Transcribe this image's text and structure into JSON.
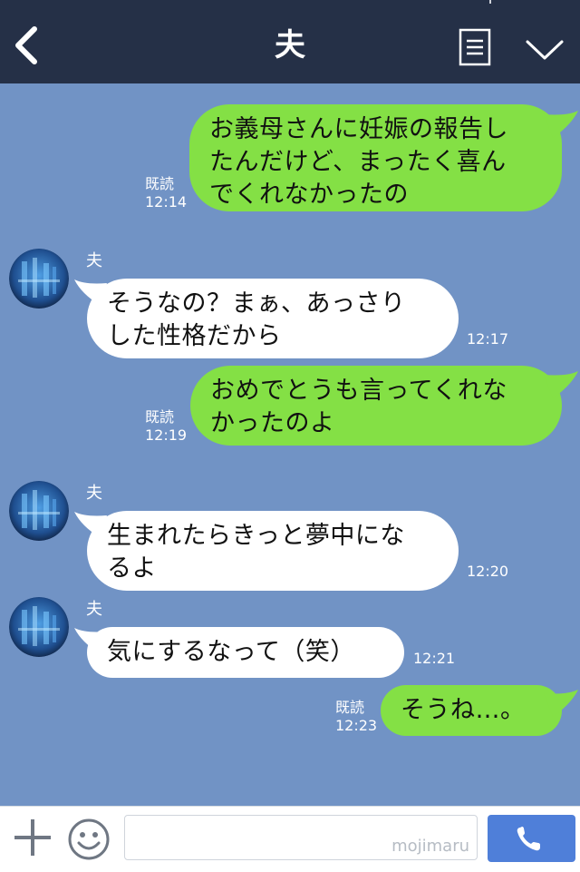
{
  "header": {
    "title": "夫",
    "back_icon": "chevron-left-icon",
    "menu_icon": "document-list-icon",
    "expand_icon": "chevron-down-icon"
  },
  "messages": [
    {
      "side": "out",
      "lines": [
        "お義母さんに妊娠の報告し",
        "たんだけど、まったく喜ん",
        "でくれなかったの"
      ],
      "read": "既読",
      "time": "12:14"
    },
    {
      "side": "in",
      "sender": "夫",
      "lines": [
        "そうなの？まぁ、あっさり",
        "した性格だから"
      ],
      "time": "12:17"
    },
    {
      "side": "out",
      "lines": [
        "おめでとうも言ってくれな",
        "かったのよ"
      ],
      "read": "既読",
      "time": "12:19"
    },
    {
      "side": "in",
      "sender": "夫",
      "lines": [
        "生まれたらきっと夢中にな",
        "るよ"
      ],
      "time": "12:20"
    },
    {
      "side": "in",
      "sender": "夫",
      "lines": [
        "気にするなって（笑）"
      ],
      "time": "12:21"
    },
    {
      "side": "out",
      "lines": [
        "そうね…。"
      ],
      "read": "既読",
      "time": "12:23"
    }
  ],
  "footer": {
    "plus_icon": "plus-icon",
    "sticker_icon": "smiley-icon",
    "input_value": "",
    "watermark": "mojimaru",
    "call_icon": "phone-icon"
  },
  "colors": {
    "background": "#7193c5",
    "header": "#253047",
    "outgoing_bubble": "#84e045",
    "incoming_bubble": "#ffffff",
    "call_button": "#4f7fd9"
  }
}
